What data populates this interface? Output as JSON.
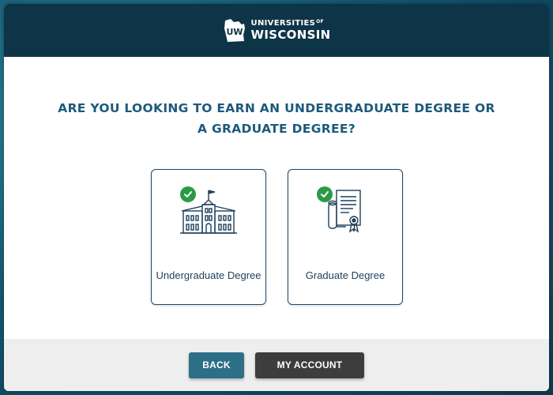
{
  "header": {
    "logo_top": "UNIVERSITIES",
    "logo_of": "OF",
    "logo_bottom": "WISCONSIN",
    "logo_mark": "UW"
  },
  "main": {
    "question": "ARE YOU LOOKING TO EARN AN UNDERGRADUATE DEGREE OR A GRADUATE DEGREE?",
    "options": [
      {
        "label": "Undergraduate Degree",
        "icon": "university-building-icon",
        "checked": true
      },
      {
        "label": "Graduate Degree",
        "icon": "diploma-certificate-icon",
        "checked": true
      }
    ]
  },
  "footer": {
    "back_label": "BACK",
    "account_label": "MY ACCOUNT"
  },
  "colors": {
    "header_bg": "#0e3447",
    "question_text": "#1d5a7c",
    "check_green": "#2b9a47",
    "back_button": "#2c6f86",
    "account_button": "#3d3d3d"
  }
}
